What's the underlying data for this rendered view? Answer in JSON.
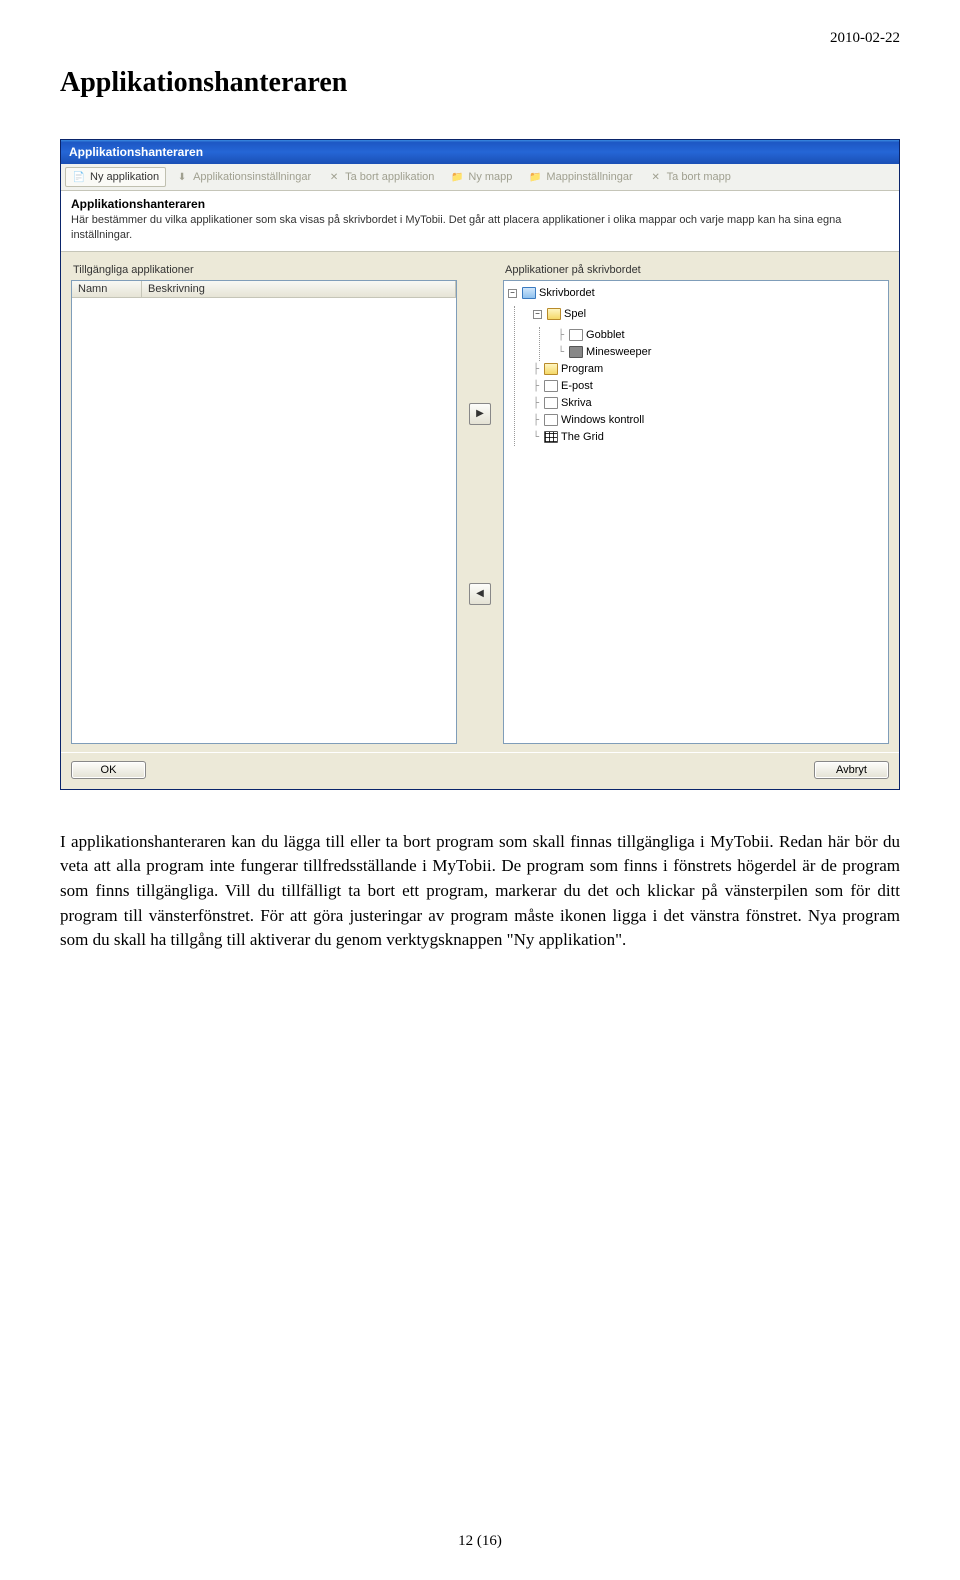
{
  "doc": {
    "date": "2010-02-22",
    "title": "Applikationshanteraren",
    "body_text": "I applikationshanteraren kan du lägga till eller ta bort program som skall finnas tillgängliga i MyTobii. Redan här bör du veta att alla program inte fungerar tillfredsställande i MyTobii. De program som finns i fönstrets högerdel är de program som finns tillgängliga. Vill du tillfälligt ta bort ett program, markerar du det och klickar på vänsterpilen som för ditt program till vänsterfönstret. För att göra justeringar av program måste ikonen ligga i det vänstra fönstret. Nya program som du skall ha tillgång till aktiverar du genom verktygsknappen \"Ny applikation\".",
    "page_number": "12 (16)"
  },
  "window": {
    "title": "Applikationshanteraren",
    "toolbar": {
      "new_app": "Ny applikation",
      "app_settings": "Applikationsinställningar",
      "delete_app": "Ta bort applikation",
      "new_folder": "Ny mapp",
      "folder_settings": "Mappinställningar",
      "delete_folder": "Ta bort mapp"
    },
    "header": {
      "heading": "Applikationshanteraren",
      "desc": "Här bestämmer du vilka applikationer som ska visas på skrivbordet i MyTobii. Det går att placera applikationer i olika mappar och varje mapp kan ha sina egna inställningar."
    },
    "left_panel": {
      "label": "Tillgängliga applikationer",
      "col_name": "Namn",
      "col_desc": "Beskrivning"
    },
    "right_panel": {
      "label": "Applikationer på skrivbordet",
      "tree": {
        "root": "Skrivbordet",
        "spel": "Spel",
        "gobblet": "Gobblet",
        "minesweeper": "Minesweeper",
        "program": "Program",
        "epost": "E-post",
        "skriva": "Skriva",
        "windows_kontroll": "Windows kontroll",
        "the_grid": "The Grid"
      }
    },
    "move": {
      "right": "▶",
      "left": "◀"
    },
    "buttons": {
      "ok": "OK",
      "cancel": "Avbryt"
    }
  }
}
